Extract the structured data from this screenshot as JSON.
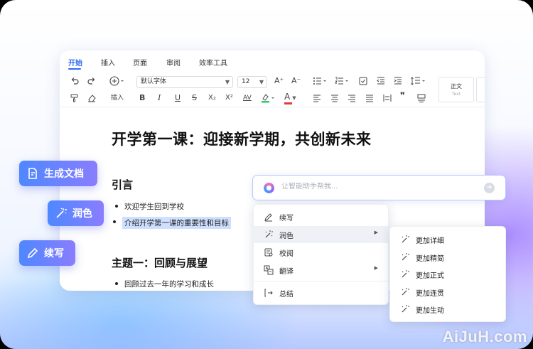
{
  "tabs": [
    "开始",
    "插入",
    "页面",
    "审阅",
    "效率工具"
  ],
  "toolbar": {
    "font_family": "默认字体",
    "font_size": "12",
    "insert_label": "插入",
    "style_normal": "正文",
    "style_normal_sub": "Text",
    "row1_icons": [
      "undo-icon",
      "redo-icon",
      "insert-plus-icon",
      "font-grow-icon",
      "font-shrink-icon",
      "bulleted-list-icon",
      "numbered-list-icon",
      "checkbox-list-icon",
      "indent-decrease-icon",
      "indent-increase-icon",
      "line-spacing-icon"
    ],
    "bold": "B",
    "italic": "I",
    "underline": "U",
    "strike": "S",
    "subscript": "X₂",
    "superscript": "X²",
    "char_spacing": "AV",
    "font_color": "A",
    "font_grow": "A⁺",
    "font_shrink": "A⁻",
    "quote": "❞"
  },
  "document": {
    "title": "开学第一课：迎接新学期，共创新未来",
    "section1_heading": "引言",
    "bullets1": [
      "欢迎学生回到学校",
      "介绍开学第一课的重要性和目标"
    ],
    "section2_heading": "主题一：回顾与展望",
    "bullets2": [
      "回顾过去一年的学习和成长"
    ]
  },
  "ai_pills": [
    "生成文档",
    "润色",
    "续写"
  ],
  "ai_box": {
    "placeholder": "让智能助手帮我..."
  },
  "menu": {
    "items": [
      "续写",
      "润色",
      "校阅",
      "翻译",
      "总结"
    ]
  },
  "submenu": {
    "items": [
      "更加详细",
      "更加精简",
      "更加正式",
      "更加连贯",
      "更加生动"
    ]
  },
  "watermark": "AiJuH.com",
  "colors": {
    "accent": "#2b6cf5",
    "highlight": "#cfe0ff",
    "pill_start": "#4e88ff",
    "pill_end": "#8a7dff",
    "font_color_bar": "#e53935",
    "highlight_color_bar": "#2ecc71"
  }
}
